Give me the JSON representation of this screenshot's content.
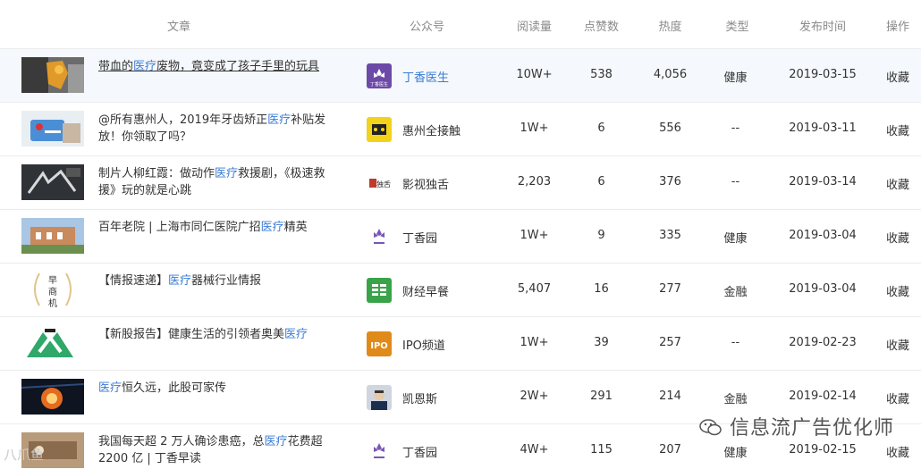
{
  "header": {
    "article": "文章",
    "account": "公众号",
    "reads": "阅读量",
    "likes": "点赞数",
    "heat": "热度",
    "type": "类型",
    "date": "发布时间",
    "op": "操作"
  },
  "rows": [
    {
      "title_a": "带血的",
      "title_hl": "医疗",
      "title_b": "废物，竟变成了孩子手里的玩具",
      "account": "丁香医生",
      "reads": "10W+",
      "likes": "538",
      "heat": "4,056",
      "type": "健康",
      "date": "2019-03-15",
      "op": "收藏"
    },
    {
      "title_a": "@所有惠州人，2019年牙齿矫正",
      "title_hl": "医疗",
      "title_b": "补贴发放！你领取了吗？",
      "account": "惠州全接触",
      "reads": "1W+",
      "likes": "6",
      "heat": "556",
      "type": "--",
      "date": "2019-03-11",
      "op": "收藏"
    },
    {
      "title_a": "制片人柳红霞：做动作",
      "title_hl": "医疗",
      "title_b": "救援剧，《极速救援》玩的就是心跳",
      "account": "影视独舌",
      "reads": "2,203",
      "likes": "6",
      "heat": "376",
      "type": "--",
      "date": "2019-03-14",
      "op": "收藏"
    },
    {
      "title_a": "百年老院 | 上海市同仁医院广招",
      "title_hl": "医疗",
      "title_b": "精英",
      "account": "丁香园",
      "reads": "1W+",
      "likes": "9",
      "heat": "335",
      "type": "健康",
      "date": "2019-03-04",
      "op": "收藏"
    },
    {
      "title_a": "【情报速递】",
      "title_hl": "医疗",
      "title_b": "器械行业情报",
      "account": "财经早餐",
      "reads": "5,407",
      "likes": "16",
      "heat": "277",
      "type": "金融",
      "date": "2019-03-04",
      "op": "收藏"
    },
    {
      "title_a": "【新股报告】健康生活的引领者奥美",
      "title_hl": "医疗",
      "title_b": "",
      "account": "IPO频道",
      "reads": "1W+",
      "likes": "39",
      "heat": "257",
      "type": "--",
      "date": "2019-02-23",
      "op": "收藏"
    },
    {
      "title_a": "",
      "title_hl": "医疗",
      "title_b": "恒久远，此股可家传",
      "account": "凯恩斯",
      "reads": "2W+",
      "likes": "291",
      "heat": "214",
      "type": "金融",
      "date": "2019-02-14",
      "op": "收藏"
    },
    {
      "title_a": "我国每天超 2 万人确诊患癌，总",
      "title_hl": "医疗",
      "title_b": "花费超 2200 亿 | 丁香早读",
      "account": "丁香园",
      "reads": "4W+",
      "likes": "115",
      "heat": "207",
      "type": "健康",
      "date": "2019-02-15",
      "op": "收藏"
    }
  ],
  "thumb_text_4": "早\n商\n机",
  "logo_text_1": "丁香医生",
  "logo_text_3": "独舌",
  "logo_text_5": "IPO",
  "watermark": "信息流广告优化师",
  "watermark2": "八爪鱼"
}
